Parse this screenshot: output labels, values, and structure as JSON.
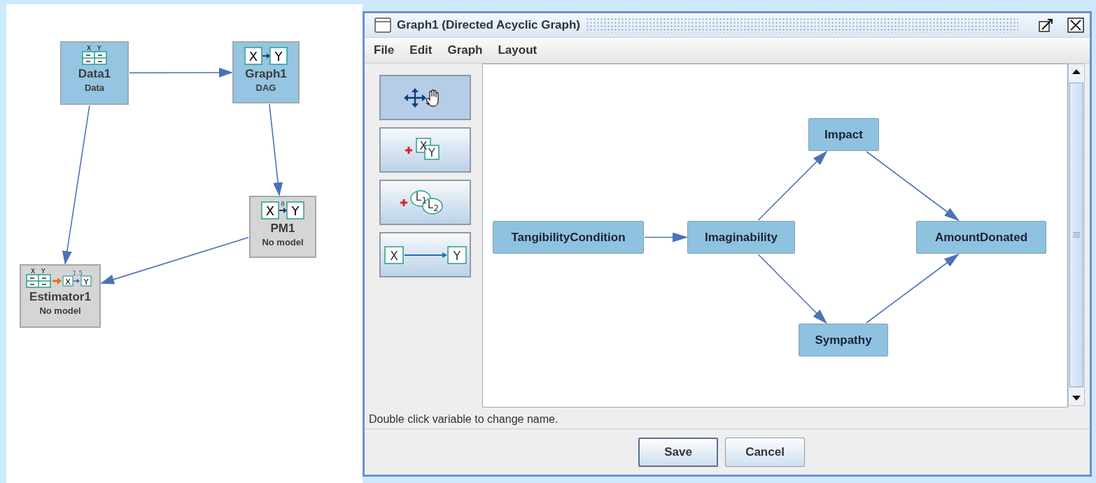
{
  "pipeline": {
    "nodes": [
      {
        "kind": "data",
        "name": "Data1",
        "subtitle": "Data",
        "glyphs": [
          "X",
          "Y"
        ]
      },
      {
        "kind": "graph",
        "name": "Graph1",
        "subtitle": "DAG",
        "glyphs": [
          "X",
          "Y"
        ]
      },
      {
        "kind": "pm",
        "name": "PM1",
        "subtitle": "No model",
        "glyphs": [
          "X",
          "θ",
          "Y"
        ]
      },
      {
        "kind": "estimator",
        "name": "Estimator1",
        "subtitle": "No model",
        "glyphs": [
          "X",
          "Y",
          "X",
          "1.5",
          "Y"
        ]
      }
    ]
  },
  "window": {
    "title": "Graph1 (Directed Acyclic Graph)",
    "menu": [
      "File",
      "Edit",
      "Graph",
      "Layout"
    ],
    "tools": [
      {
        "kind": "move",
        "selected": true
      },
      {
        "kind": "add-variable",
        "selected": false,
        "glyphs": [
          "X",
          "Y"
        ]
      },
      {
        "kind": "add-latent",
        "selected": false,
        "glyphs": [
          "L$_{1}$",
          "L$_{2}$"
        ]
      },
      {
        "kind": "add-edge",
        "selected": false,
        "glyphs": [
          "X",
          "Y"
        ]
      }
    ],
    "graph": {
      "nodes": [
        {
          "name": "TangibilityCondition"
        },
        {
          "name": "Imaginability"
        },
        {
          "name": "Impact"
        },
        {
          "name": "AmountDonated"
        },
        {
          "name": "Sympathy"
        }
      ]
    },
    "status": "Double click variable to change name.",
    "buttons": [
      "Save",
      "Cancel"
    ]
  }
}
